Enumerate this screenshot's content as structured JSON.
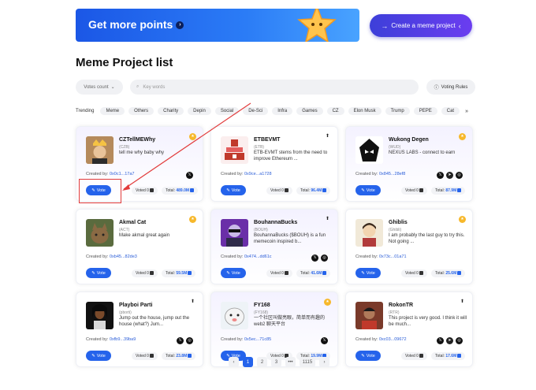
{
  "banner": {
    "title": "Get more points"
  },
  "create_button": {
    "label": "Create a meme project"
  },
  "page_title": "Meme Project list",
  "filters": {
    "sort_label": "Votes count",
    "search_placeholder": "Key words",
    "voting_rules": "Voting Rules",
    "trending_label": "Trending",
    "tags": [
      "Meme",
      "Others",
      "Charity",
      "Depin",
      "Social",
      "De-Sci",
      "Infra",
      "Games",
      "CZ",
      "Elon Musk",
      "Trump",
      "PEPE",
      "Cat"
    ]
  },
  "vote_label": "Vote",
  "created_label": "Created by:",
  "cards": [
    {
      "name": "CZTellMEWhy",
      "ticker": "(CZB)",
      "desc": "tell me why baby why",
      "addr": "0x0c1...17a7",
      "voted": "Voted 0",
      "total": "489.0M",
      "badge": "coin"
    },
    {
      "name": "ETBEVMT",
      "ticker": "(ETB)",
      "desc": "ETB-EVMT stems from the need to improve Ethereum ...",
      "addr": "0x9ce...a1728",
      "voted": "Voted 0",
      "total": "96.4M",
      "badge": "up"
    },
    {
      "name": "Wukong Degen",
      "ticker": "(WUD)",
      "desc": "NEXUS LABS - connect to earn",
      "addr": "0x845...28ef8",
      "voted": "Voted 0",
      "total": "87.9M",
      "badge": "coin"
    },
    {
      "name": "Akmal Cat",
      "ticker": "(ACT)",
      "desc": "Make akmal great again",
      "addr": "0xb45...82de3",
      "voted": "Voted 0",
      "total": "59.5M",
      "badge": "coin"
    },
    {
      "name": "BouhannaBucks",
      "ticker": "(BOUH)",
      "desc": "BouhannaBucks ($BOUH) is a fun memecoin inspired b...",
      "addr": "0x474...dd61c",
      "voted": "Voted 0",
      "total": "41.6M",
      "badge": "up"
    },
    {
      "name": "Ghiblis",
      "ticker": "(Ghibli)",
      "desc": "I am probably the last guy to try this. Not going ...",
      "addr": "0x73c...01a71",
      "voted": "Voted 0",
      "total": "25.6M",
      "badge": "coin"
    },
    {
      "name": "Playboi Parti",
      "ticker": "(pborti)",
      "desc": "Jump out the house, jump out the house (what?) Jum...",
      "addr": "0xfb9...39ba9",
      "voted": "Voted 0",
      "total": "23.8M",
      "badge": "up"
    },
    {
      "name": "FY168",
      "ticker": "(FY168)",
      "desc": "一个社区叫做亮眼，简单而有趣的web2 聊天平台",
      "addr": "0x5ec...71c85",
      "voted": "Voted 0",
      "total": "19.9M",
      "badge": "coin"
    },
    {
      "name": "RokonTR",
      "ticker": "(RTR)",
      "desc": "This project is very good. I think it will be much...",
      "addr": "0xc03...09672",
      "voted": "Voted 0",
      "total": "17.6M",
      "badge": "up"
    }
  ],
  "total_prefix": "Total:",
  "pagination": {
    "prev": "‹",
    "pages": [
      "1",
      "2",
      "3"
    ],
    "ellipsis": "•••",
    "last": "1115",
    "next": "›"
  }
}
